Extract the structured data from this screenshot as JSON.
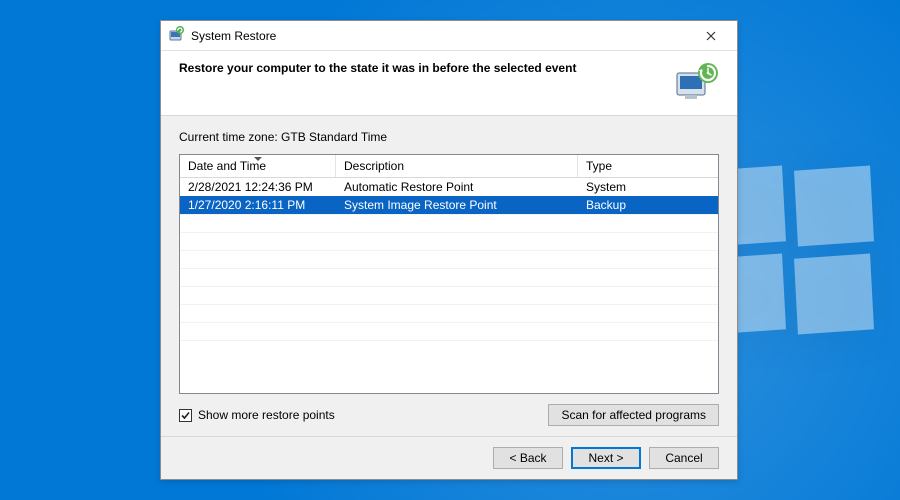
{
  "window": {
    "title": "System Restore"
  },
  "header": {
    "title": "Restore your computer to the state it was in before the selected event"
  },
  "timezone_label": "Current time zone: GTB Standard Time",
  "grid": {
    "columns": {
      "date": "Date and Time",
      "description": "Description",
      "type": "Type"
    },
    "sorted_column": "date",
    "rows": [
      {
        "date": "2/28/2021 12:24:36 PM",
        "description": "Automatic Restore Point",
        "type": "System",
        "selected": false
      },
      {
        "date": "1/27/2020 2:16:11 PM",
        "description": "System Image Restore Point",
        "type": "Backup",
        "selected": true
      }
    ]
  },
  "show_more": {
    "checked": true,
    "label": "Show more restore points"
  },
  "scan_button": "Scan for affected programs",
  "footer": {
    "back": "< Back",
    "next": "Next >",
    "cancel": "Cancel"
  }
}
